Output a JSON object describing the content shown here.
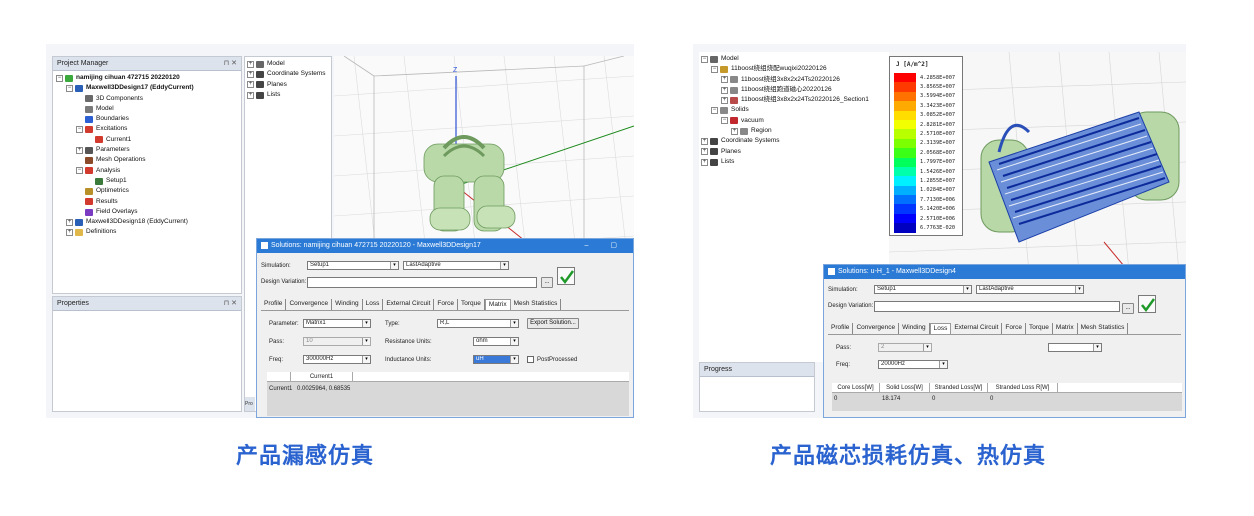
{
  "screenshot1": {
    "project_manager": {
      "title": "Project Manager",
      "pin_close": "⊓ ✕",
      "tree": [
        {
          "label": "namijing cihuan 472715 20220120",
          "depth": 0,
          "exp": "⊟",
          "icon": "project-icon",
          "color": "#3ca93c",
          "bold": true
        },
        {
          "label": "Maxwell3DDesign17 (EddyCurrent)",
          "depth": 1,
          "exp": "⊟",
          "icon": "design-icon",
          "color": "#2a5fb8",
          "bold": true
        },
        {
          "label": "3D Components",
          "depth": 2,
          "exp": "",
          "icon": "components-icon",
          "color": "#6a6a6a"
        },
        {
          "label": "Model",
          "depth": 2,
          "exp": "",
          "icon": "model-icon",
          "color": "#7a7a7a"
        },
        {
          "label": "Boundaries",
          "depth": 2,
          "exp": "",
          "icon": "boundaries-icon",
          "color": "#2c5fd1"
        },
        {
          "label": "Excitations",
          "depth": 2,
          "exp": "⊟",
          "icon": "excitations-icon",
          "color": "#d13a2c"
        },
        {
          "label": "Current1",
          "depth": 3,
          "exp": "",
          "icon": "current-icon",
          "color": "#d13a2c"
        },
        {
          "label": "Parameters",
          "depth": 2,
          "exp": "⊞",
          "icon": "parameters-icon",
          "color": "#555555"
        },
        {
          "label": "Mesh Operations",
          "depth": 2,
          "exp": "",
          "icon": "mesh-icon",
          "color": "#8a4a2a"
        },
        {
          "label": "Analysis",
          "depth": 2,
          "exp": "⊟",
          "icon": "analysis-icon",
          "color": "#d13a2c"
        },
        {
          "label": "Setup1",
          "depth": 3,
          "exp": "",
          "icon": "setup-icon",
          "color": "#3a7a3a"
        },
        {
          "label": "Optimetrics",
          "depth": 2,
          "exp": "",
          "icon": "optimetrics-icon",
          "color": "#b8902a"
        },
        {
          "label": "Results",
          "depth": 2,
          "exp": "",
          "icon": "results-icon",
          "color": "#d13a2c"
        },
        {
          "label": "Field Overlays",
          "depth": 2,
          "exp": "",
          "icon": "field-overlays-icon",
          "color": "#7a3ac1"
        },
        {
          "label": "Maxwell3DDesign18 (EddyCurrent)",
          "depth": 1,
          "exp": "⊞",
          "icon": "design-icon",
          "color": "#2a5fb8"
        },
        {
          "label": "Definitions",
          "depth": 1,
          "exp": "⊞",
          "icon": "folder-icon",
          "color": "#e0b84a"
        }
      ]
    },
    "properties": {
      "title": "Properties",
      "pin_close": "⊓ ✕"
    },
    "model_tree": [
      {
        "label": "Model",
        "icon": "model-icon",
        "color": "#666666"
      },
      {
        "label": "Coordinate Systems",
        "icon": "coordinate-icon",
        "color": "#444444"
      },
      {
        "label": "Planes",
        "icon": "planes-icon",
        "color": "#444444"
      },
      {
        "label": "Lists",
        "icon": "lists-icon",
        "color": "#444444"
      }
    ],
    "side_tab": "Pro",
    "axis_label": "Z",
    "solutions": {
      "title": "Solutions: namijing cihuan 472715 20220120 - Maxwell3DDesign17",
      "win_buttons": "–   ▢",
      "simulation_label": "Simulation:",
      "simulation": "Setup1",
      "solution": "LastAdaptive",
      "design_variation_label": "Design Variation:",
      "ellipsis": "...",
      "tabs": [
        "Profile",
        "Convergence",
        "Winding",
        "Loss",
        "External Circuit",
        "Force",
        "Torque",
        "Matrix",
        "Mesh Statistics"
      ],
      "active_tab": "Matrix",
      "parameter_label": "Parameter:",
      "parameter": "Matrix1",
      "type_label": "Type:",
      "type": "R,L",
      "export_button": "Export Solution...",
      "pass_label": "Pass:",
      "pass": "10",
      "resistance_units_label": "Resistance Units:",
      "resistance_units": "ohm",
      "freq_label": "Freq:",
      "freq": "300000Hz",
      "inductance_units_label": "Inductance Units:",
      "inductance_units": "uH",
      "postprocessed_label": "PostProcessed",
      "grid_col": "Current1",
      "grid_row_label": "Current1",
      "grid_row_value": "0.0025964, 0.68535"
    }
  },
  "screenshot2": {
    "tree": [
      {
        "label": "Model",
        "depth": 0,
        "exp": "⊟",
        "icon": "model-icon",
        "color": "#666666"
      },
      {
        "label": "11boost绕组烧配wuqixi20220126",
        "depth": 1,
        "exp": "⊟",
        "icon": "group-icon",
        "color": "#c69a2a"
      },
      {
        "label": "11boost绕组3x8x2x24Ts20220126",
        "depth": 2,
        "exp": "⊞",
        "icon": "object-icon",
        "color": "#888888"
      },
      {
        "label": "11boost绕组跑道磁心20220126",
        "depth": 2,
        "exp": "⊞",
        "icon": "object-icon",
        "color": "#888888"
      },
      {
        "label": "11boost绕组3x8x2x24Ts20220126_Section1",
        "depth": 2,
        "exp": "⊞",
        "icon": "section-icon",
        "color": "#b84a4a"
      },
      {
        "label": "Solids",
        "depth": 1,
        "exp": "⊟",
        "icon": "solids-icon",
        "color": "#888888"
      },
      {
        "label": "vacuum",
        "depth": 2,
        "exp": "⊟",
        "icon": "material-icon",
        "color": "#c0282e"
      },
      {
        "label": "Region",
        "depth": 3,
        "exp": "⊞",
        "icon": "region-icon",
        "color": "#888888"
      },
      {
        "label": "Coordinate Systems",
        "depth": 0,
        "exp": "⊞",
        "icon": "coordinate-icon",
        "color": "#444444"
      },
      {
        "label": "Planes",
        "depth": 0,
        "exp": "⊞",
        "icon": "planes-icon",
        "color": "#444444"
      },
      {
        "label": "Lists",
        "depth": 0,
        "exp": "⊞",
        "icon": "lists-icon",
        "color": "#444444"
      }
    ],
    "progress_title": "Progress",
    "legend": {
      "title": "J [A/m^2]",
      "values": [
        "4.2858E+007",
        "3.8565E+007",
        "3.5994E+007",
        "3.3423E+007",
        "3.0852E+007",
        "2.8281E+007",
        "2.5710E+007",
        "2.3139E+007",
        "2.0568E+007",
        "1.7997E+007",
        "1.5426E+007",
        "1.2855E+007",
        "1.0284E+007",
        "7.7130E+006",
        "5.1420E+006",
        "2.5710E+006",
        "6.7763E-020"
      ],
      "colors": [
        "#ff0000",
        "#ff3a00",
        "#ff7200",
        "#ffaa00",
        "#ffdd00",
        "#f2ff00",
        "#b8ff00",
        "#7cff00",
        "#3cff18",
        "#00ff5a",
        "#00ffaa",
        "#00f0ff",
        "#00b0ff",
        "#0070ff",
        "#0036ff",
        "#0000ff",
        "#0000c0"
      ]
    },
    "solutions": {
      "title": "Solutions: u-H_1 - Maxwell3DDesign4",
      "simulation_label": "Simulation:",
      "simulation": "Setup1",
      "solution": "LastAdaptive",
      "design_variation_label": "Design Variation:",
      "ellipsis": "...",
      "tabs": [
        "Profile",
        "Convergence",
        "Winding",
        "Loss",
        "External Circuit",
        "Force",
        "Torque",
        "Matrix",
        "Mesh Statistics"
      ],
      "active_tab": "Loss",
      "pass_label": "Pass:",
      "pass": "2",
      "freq_label": "Freq:",
      "freq": "20000Hz",
      "extra_select": "",
      "grid_cols": [
        "Core Loss[W]",
        "Solid Loss[W]",
        "Stranded Loss[W]",
        "Stranded Loss R[W]"
      ],
      "grid_values": [
        "0",
        "18.174",
        "0",
        "0"
      ]
    }
  },
  "captions": {
    "left": "产品漏感仿真",
    "right": "产品磁芯损耗仿真、热仿真"
  }
}
